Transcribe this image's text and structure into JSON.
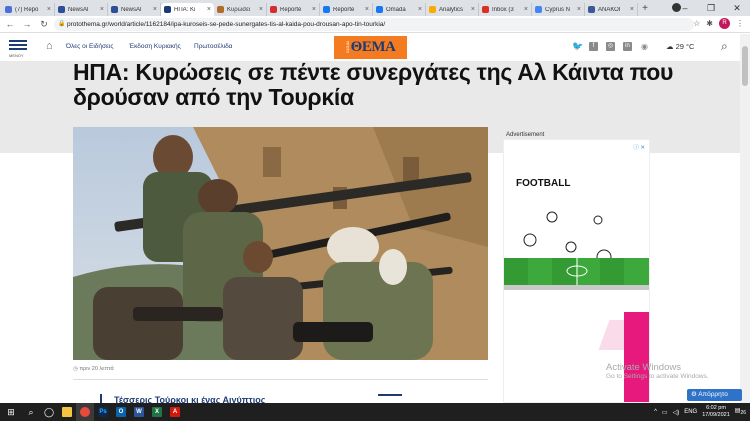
{
  "browser": {
    "tabs": [
      {
        "label": "(7) Repo",
        "color": "#4a6fdc"
      },
      {
        "label": "NewsAl",
        "color": "#2d4f9a"
      },
      {
        "label": "NewsAl",
        "color": "#2d4f9a"
      },
      {
        "label": "ΗΠΑ: Κι",
        "color": "#1d3b73",
        "active": true
      },
      {
        "label": "Κυρώσει",
        "color": "#b06a2a"
      },
      {
        "label": "Reporte",
        "color": "#d32f2f"
      },
      {
        "label": "Reporte",
        "color": "#1877f2"
      },
      {
        "label": "Omada",
        "color": "#1877f2"
      },
      {
        "label": "Analytics",
        "color": "#f9ab00"
      },
      {
        "label": "Inbox (3",
        "color": "#d93025"
      },
      {
        "label": "Cyprus N",
        "color": "#4285f4"
      },
      {
        "label": "ΑΝΑΚΟΙ",
        "color": "#3b5998"
      }
    ],
    "url": "protothema.gr/world/article/1162184/ipa-kuroseis-se-pede-sunergates-tis-al-kaida-pou-drousan-apo-tin-tourkia/",
    "profile_initial": "R"
  },
  "site": {
    "menu_label": "ΜΕΝΟΥ",
    "nav": [
      "Όλες οι Ειδήσεις",
      "Έκδοση Κυριακής",
      "Πρωτοσέλιδα"
    ],
    "logo_small": "ΠΡΩΤΟ",
    "logo_big": "ΘΕΜΑ",
    "temperature": "29 °C"
  },
  "article": {
    "headline": "ΗΠΑ: Κυρώσεις σε πέντε συνεργάτες της Αλ Κάιντα που δρούσαν από την Τουρκία",
    "timestamp": "πριν 20 λεπτά",
    "related_title": "Τέσσερις Τούρκοι κι ένας Αιγύπτιος"
  },
  "ad": {
    "label": "Advertisement",
    "title": "FOOTBALL"
  },
  "overlay": {
    "activate_title": "Activate Windows",
    "activate_sub": "Go to Settings to activate Windows.",
    "chat_label": "Απόρρητο"
  },
  "taskbar": {
    "language": "ENG",
    "time": "6:02 pm",
    "date": "17/09/2021",
    "notifications": "26"
  }
}
